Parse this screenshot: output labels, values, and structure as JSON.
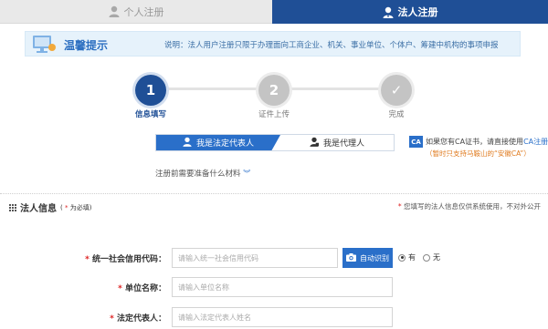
{
  "tabs": {
    "personal": "个人注册",
    "legal": "法人注册"
  },
  "notice": {
    "title": "温馨提示",
    "text": "说明：法人用户注册只限于办理面向工商企业、机关、事业单位、个体户、筹建中机构的事项申报"
  },
  "steps": [
    {
      "number": "1",
      "label": "信息填写"
    },
    {
      "number": "2",
      "label": "证件上传"
    },
    {
      "number": "✓",
      "label": "完成"
    }
  ],
  "agent_toggle": {
    "self": "我是法定代表人",
    "agent": "我是代理人"
  },
  "ca": {
    "badge": "CA",
    "text": "如果您有CA证书，请直接使用",
    "link": "CA注册",
    "note": "（暂时只支持马鞍山的“安徽CA”）"
  },
  "prep_link": "注册前需要准备什么材料",
  "section": {
    "title": "法人信息",
    "required_prefix": "( ",
    "required_star": "*",
    "required_text": " 为必填)",
    "note_star": "*",
    "note": " 您填写的法人信息仅供系统使用，不对外公开"
  },
  "form": {
    "credit_code": {
      "label": "统一社会信用代码：",
      "placeholder": "请输入统一社会信用代码"
    },
    "ocr_button": "自动识别",
    "radio_yes": "有",
    "radio_no": "无",
    "unit_name": {
      "label": "单位名称：",
      "placeholder": "请输入单位名称"
    },
    "legal_rep": {
      "label": "法定代表人：",
      "placeholder": "请输入法定代表人姓名"
    }
  },
  "colors": {
    "primary": "#1f4f96",
    "accent": "#2a6fc9",
    "warning": "#e07b1f",
    "required": "#dd2222"
  }
}
